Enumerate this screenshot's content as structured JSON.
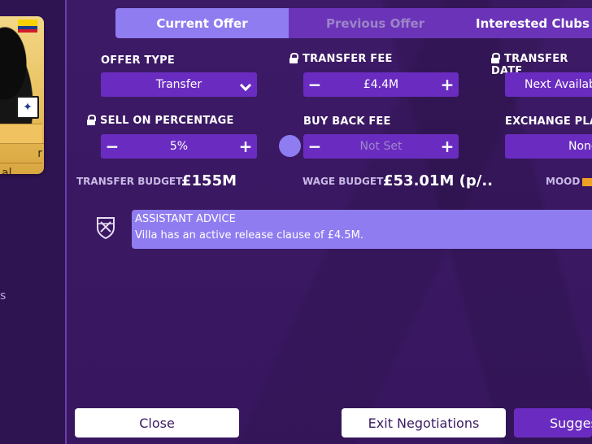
{
  "tabs": {
    "current": "Current Offer",
    "previous": "Previous Offer",
    "interested": "Interested Clubs"
  },
  "fields": {
    "offer_type": {
      "label": "OFFER TYPE",
      "value": "Transfer"
    },
    "transfer_fee": {
      "label": "TRANSFER FEE",
      "value": "£4.4M"
    },
    "transfer_date": {
      "label": "TRANSFER DATE",
      "value": "Next Availab"
    },
    "sell_on": {
      "label": "SELL ON PERCENTAGE",
      "value": "5%"
    },
    "buy_back": {
      "label": "BUY BACK FEE",
      "value": "Not Set"
    },
    "exchange": {
      "label": "EXCHANGE PLAYE",
      "value": "None"
    }
  },
  "stats": {
    "transfer_budget_label": "TRANSFER BUDGET",
    "transfer_budget_value": "£155M",
    "wage_budget_label": "WAGE BUDGET",
    "wage_budget_value": "£53.01M (p/..",
    "mood_label": "MOOD"
  },
  "advice": {
    "title": "ASSISTANT ADVICE",
    "text": "Villa has an active release clause of £4.5M."
  },
  "player_card": {
    "row1": "",
    "row2": "r",
    "row3": "al"
  },
  "side": {
    "letter": "s"
  },
  "buttons": {
    "close": "Close",
    "exit": "Exit Negotiations",
    "suggest": "Sugges"
  },
  "colors": {
    "background": "#3b1a63",
    "accent": "#8f7cf0",
    "control": "#6a2cc0",
    "mood": "#f0a224"
  }
}
